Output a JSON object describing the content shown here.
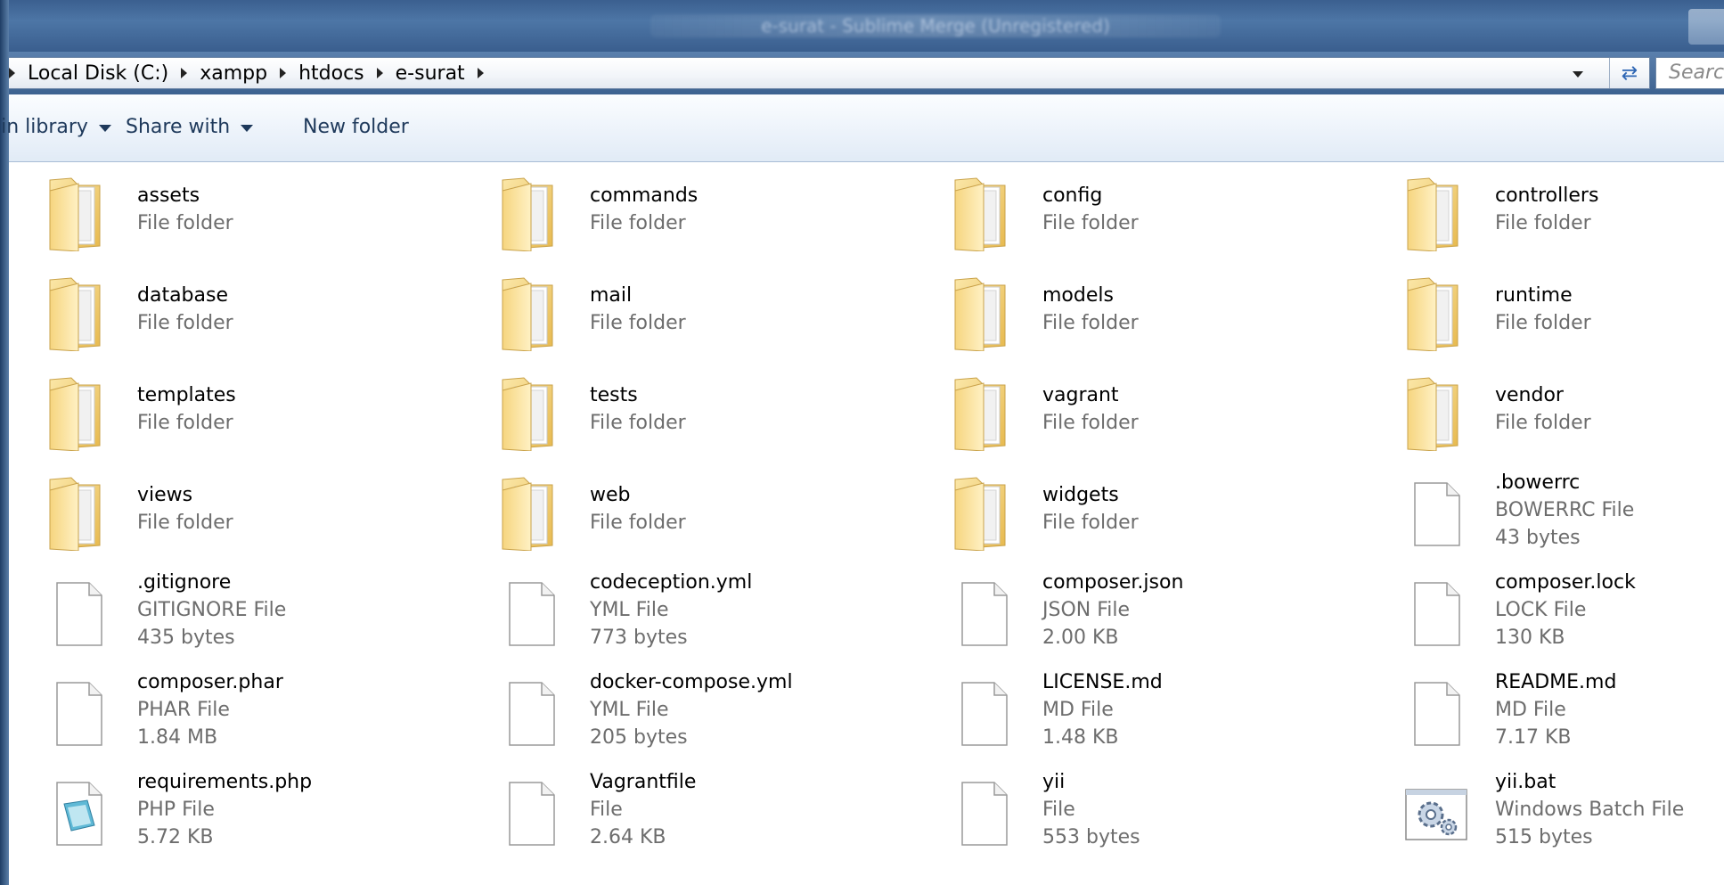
{
  "titlebar": {
    "title": "e-surat - Sublime Merge (Unregistered)"
  },
  "addressbar": {
    "crumbs": [
      "Local Disk (C:)",
      "xampp",
      "htdocs",
      "e-surat"
    ],
    "search_placeholder": "Search e-surat"
  },
  "toolbar": {
    "include_label": "Include in library",
    "share_label": "Share with",
    "newfolder_label": "New folder"
  },
  "items": [
    {
      "name": "assets",
      "type": "File folder",
      "size": "",
      "icon": "folder-icon"
    },
    {
      "name": "commands",
      "type": "File folder",
      "size": "",
      "icon": "folder-icon"
    },
    {
      "name": "config",
      "type": "File folder",
      "size": "",
      "icon": "folder-icon"
    },
    {
      "name": "controllers",
      "type": "File folder",
      "size": "",
      "icon": "folder-icon"
    },
    {
      "name": "database",
      "type": "File folder",
      "size": "",
      "icon": "folder-icon"
    },
    {
      "name": "mail",
      "type": "File folder",
      "size": "",
      "icon": "folder-icon"
    },
    {
      "name": "models",
      "type": "File folder",
      "size": "",
      "icon": "folder-icon"
    },
    {
      "name": "runtime",
      "type": "File folder",
      "size": "",
      "icon": "folder-icon"
    },
    {
      "name": "templates",
      "type": "File folder",
      "size": "",
      "icon": "folder-icon"
    },
    {
      "name": "tests",
      "type": "File folder",
      "size": "",
      "icon": "folder-icon"
    },
    {
      "name": "vagrant",
      "type": "File folder",
      "size": "",
      "icon": "folder-icon"
    },
    {
      "name": "vendor",
      "type": "File folder",
      "size": "",
      "icon": "folder-icon"
    },
    {
      "name": "views",
      "type": "File folder",
      "size": "",
      "icon": "folder-icon"
    },
    {
      "name": "web",
      "type": "File folder",
      "size": "",
      "icon": "folder-icon"
    },
    {
      "name": "widgets",
      "type": "File folder",
      "size": "",
      "icon": "folder-icon"
    },
    {
      "name": ".bowerrc",
      "type": "BOWERRC File",
      "size": "43 bytes",
      "icon": "blank-file-icon"
    },
    {
      "name": ".gitignore",
      "type": "GITIGNORE File",
      "size": "435 bytes",
      "icon": "blank-file-icon"
    },
    {
      "name": "codeception.yml",
      "type": "YML File",
      "size": "773 bytes",
      "icon": "blank-file-icon"
    },
    {
      "name": "composer.json",
      "type": "JSON File",
      "size": "2.00 KB",
      "icon": "blank-file-icon"
    },
    {
      "name": "composer.lock",
      "type": "LOCK File",
      "size": "130 KB",
      "icon": "blank-file-icon"
    },
    {
      "name": "composer.phar",
      "type": "PHAR File",
      "size": "1.84 MB",
      "icon": "blank-file-icon"
    },
    {
      "name": "docker-compose.yml",
      "type": "YML File",
      "size": "205 bytes",
      "icon": "blank-file-icon"
    },
    {
      "name": "LICENSE.md",
      "type": "MD File",
      "size": "1.48 KB",
      "icon": "blank-file-icon"
    },
    {
      "name": "README.md",
      "type": "MD File",
      "size": "7.17 KB",
      "icon": "blank-file-icon"
    },
    {
      "name": "requirements.php",
      "type": "PHP File",
      "size": "5.72 KB",
      "icon": "php-file-icon"
    },
    {
      "name": "Vagrantfile",
      "type": "File",
      "size": "2.64 KB",
      "icon": "blank-file-icon"
    },
    {
      "name": "yii",
      "type": "File",
      "size": "553 bytes",
      "icon": "blank-file-icon"
    },
    {
      "name": "yii.bat",
      "type": "Windows Batch File",
      "size": "515 bytes",
      "icon": "batch-file-icon"
    }
  ],
  "colors": {
    "titlebar": "#4d76a6",
    "toolbar_text": "#1e395b",
    "folder_yellow": "#f3d27a",
    "secondary_text": "#6d6d6d"
  }
}
